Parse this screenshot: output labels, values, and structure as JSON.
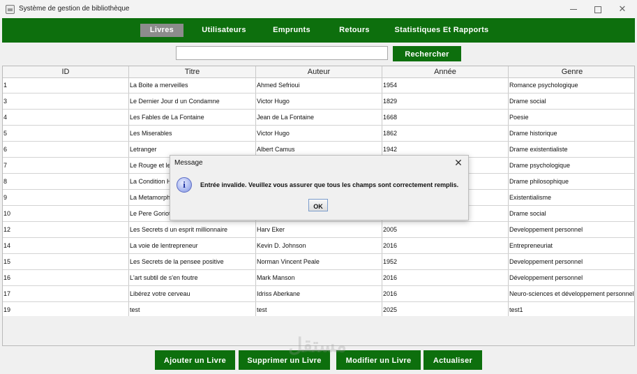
{
  "window": {
    "title": "Système de gestion de bibliothèque"
  },
  "menu": [
    {
      "label": "Livres",
      "active": true
    },
    {
      "label": "Utilisateurs",
      "active": false
    },
    {
      "label": "Emprunts",
      "active": false
    },
    {
      "label": "Retours",
      "active": false
    },
    {
      "label": "Statistiques Et Rapports",
      "active": false
    }
  ],
  "search": {
    "value": "",
    "button": "Rechercher"
  },
  "table": {
    "columns": [
      "ID",
      "Titre",
      "Auteur",
      "Année",
      "Genre"
    ],
    "rows": [
      [
        "1",
        "La Boite a merveilles",
        "Ahmed Sefrioui",
        "1954",
        "Romance psychologique"
      ],
      [
        "3",
        "Le Dernier Jour d un Condamne",
        "Victor Hugo",
        "1829",
        "Drame social"
      ],
      [
        "4",
        "Les Fables de La Fontaine",
        "Jean de La Fontaine",
        "1668",
        "Poesie"
      ],
      [
        "5",
        "Les Miserables",
        "Victor Hugo",
        "1862",
        "Drame historique"
      ],
      [
        "6",
        "Letranger",
        "Albert Camus",
        "1942",
        "Drame existentialiste"
      ],
      [
        "7",
        "Le Rouge et le",
        "",
        "",
        "Drame psychologique"
      ],
      [
        "8",
        "La Condition H",
        "",
        "",
        "Drame philosophique"
      ],
      [
        "9",
        "La Metamorph",
        "",
        "",
        "Existentialisme"
      ],
      [
        "10",
        "Le Pere Goriot",
        "",
        "",
        "Drame social"
      ],
      [
        "12",
        "Les Secrets d un esprit millionnaire",
        "Harv Eker",
        "2005",
        "Developpement personnel"
      ],
      [
        "14",
        "La voie de lentrepreneur",
        "Kevin D. Johnson",
        "2016",
        "Entrepreneuriat"
      ],
      [
        "15",
        "Les Secrets de la pensee positive",
        "Norman Vincent Peale",
        "1952",
        "Developpement personnel"
      ],
      [
        "16",
        "L'art subtil de s'en foutre",
        "Mark Manson",
        "2016",
        "Développement personnel"
      ],
      [
        "17",
        "Libérez votre cerveau",
        "Idriss Aberkane",
        "2016",
        "Neuro-sciences et développement personnel"
      ],
      [
        "19",
        "test",
        "test",
        "2025",
        "test1"
      ]
    ]
  },
  "actions": {
    "add": "Ajouter un Livre",
    "delete": "Supprimer un Livre",
    "edit": "Modifier un Livre",
    "refresh": "Actualiser"
  },
  "watermark": "مستقل mostaql.com",
  "dialog": {
    "title": "Message",
    "message": "Entrée invalide. Veuillez vous assurer que tous les champs sont correctement remplis.",
    "ok": "OK",
    "icon": "info-icon"
  },
  "colors": {
    "accent": "#0d6f0d",
    "active_tab": "#8c8c8c"
  }
}
